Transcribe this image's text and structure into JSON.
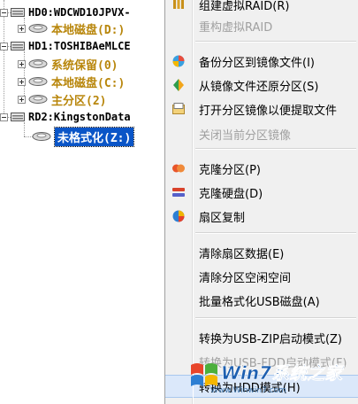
{
  "tree": {
    "disks": [
      {
        "label": "HD0:WDCWD10JPVX-",
        "partitions": [
          {
            "label": "本地磁盘(D:)",
            "selected": false
          }
        ]
      },
      {
        "label": "HD1:TOSHIBAeMLCE",
        "partitions": [
          {
            "label": "系统保留(0)",
            "selected": false
          },
          {
            "label": "本地磁盘(C:)",
            "selected": false
          },
          {
            "label": "主分区(2)",
            "selected": false
          }
        ]
      },
      {
        "label": "RD2:KingstonData",
        "partitions": [
          {
            "label": "未格式化(Z:)",
            "selected": true
          }
        ]
      }
    ]
  },
  "menu": {
    "items": [
      {
        "label": "组建虚拟RAID(R)",
        "icon": "raid-icon",
        "disabled": false
      },
      {
        "label": "重构虚拟RAID",
        "icon": "",
        "disabled": true
      },
      {
        "label": "备份分区到镜像文件(I)",
        "icon": "backup-icon",
        "disabled": false
      },
      {
        "label": "从镜像文件还原分区(S)",
        "icon": "restore-icon",
        "disabled": false
      },
      {
        "label": "打开分区镜像以便提取文件",
        "icon": "open-image-icon",
        "disabled": false
      },
      {
        "label": "关闭当前分区镜像",
        "icon": "",
        "disabled": true
      },
      {
        "label": "克隆分区(P)",
        "icon": "clone-partition-icon",
        "disabled": false
      },
      {
        "label": "克隆硬盘(D)",
        "icon": "clone-disk-icon",
        "disabled": false
      },
      {
        "label": "扇区复制",
        "icon": "sector-copy-icon",
        "disabled": false
      },
      {
        "label": "清除扇区数据(E)",
        "icon": "",
        "disabled": false
      },
      {
        "label": "清除分区空闲空间",
        "icon": "",
        "disabled": false
      },
      {
        "label": "批量格式化USB磁盘(A)",
        "icon": "",
        "disabled": false
      },
      {
        "label": "转换为USB-ZIP启动模式(Z)",
        "icon": "",
        "disabled": false
      },
      {
        "label": "转换为USB-FDD启动模式(F)",
        "icon": "",
        "disabled": true
      },
      {
        "label": "转换为HDD模式(H)",
        "icon": "",
        "disabled": false,
        "highlighted": true
      }
    ]
  },
  "watermark": {
    "brand": "Win7系统之家",
    "url": "Www.Winwin7.com"
  }
}
